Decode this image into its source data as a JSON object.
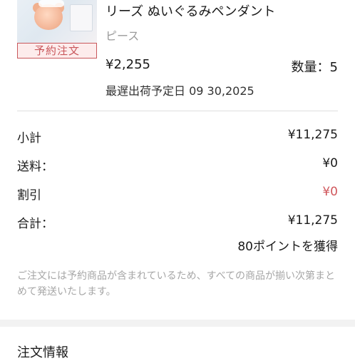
{
  "product": {
    "name": "リーズ ぬいぐるみペンダント",
    "variant": "ピース",
    "badge": "予約注文",
    "price": "¥2,255",
    "quantity": "数量：5",
    "ship_date": "最遅出荷予定日 09 30,2025"
  },
  "summary": {
    "subtotal_label": "小計",
    "subtotal_value": "¥11,275",
    "shipping_label": "送料：",
    "shipping_value": "¥0",
    "discount_label": "割引",
    "discount_value": "¥0",
    "total_label": "合計：",
    "total_value": "¥11,275",
    "points": "80ポイントを獲得"
  },
  "note": "ご注文には予約商品が含まれているため、すべての商品が揃い次第まとめて発送いたします。",
  "section": {
    "title": "注文情報"
  },
  "colors": {
    "accent_red": "#d0575c",
    "muted_text": "#a6a6a6"
  }
}
